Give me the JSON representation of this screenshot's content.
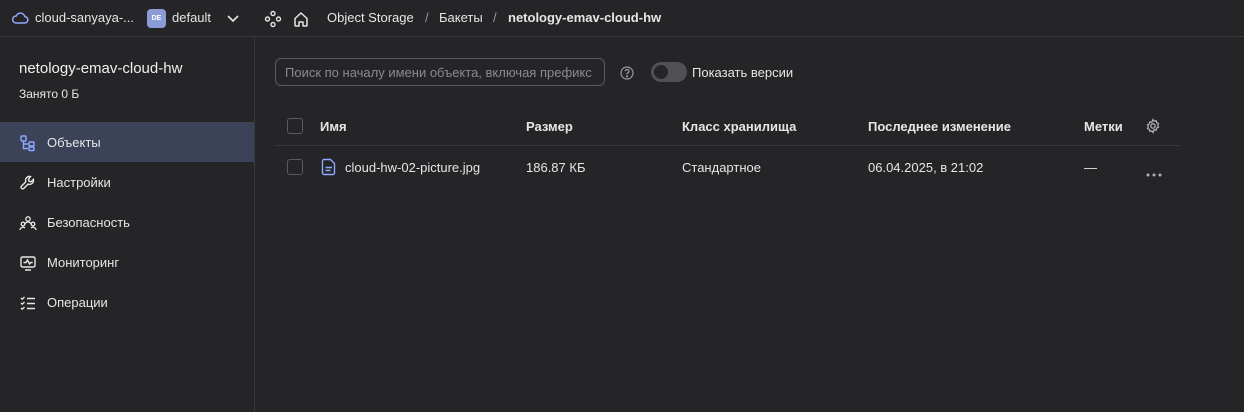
{
  "topbar": {
    "cloud_name": "cloud-sanyaya-...",
    "folder_badge": "DE",
    "folder_name": "default",
    "breadcrumbs": [
      "Object Storage",
      "Бакеты",
      "netology-emav-cloud-hw"
    ],
    "separator": "/"
  },
  "sidebar": {
    "bucket_name": "netology-emav-cloud-hw",
    "used": "Занято 0 Б",
    "items": [
      {
        "label": "Объекты",
        "icon": "objects-icon",
        "active": true
      },
      {
        "label": "Настройки",
        "icon": "wrench-icon",
        "active": false
      },
      {
        "label": "Безопасность",
        "icon": "users-icon",
        "active": false
      },
      {
        "label": "Мониторинг",
        "icon": "monitor-icon",
        "active": false
      },
      {
        "label": "Операции",
        "icon": "list-icon",
        "active": false
      }
    ]
  },
  "toolbar": {
    "search_placeholder": "Поиск по началу имени объекта, включая префикс",
    "show_versions_label": "Показать версии",
    "show_versions_on": false
  },
  "table": {
    "columns": [
      "Имя",
      "Размер",
      "Класс хранилища",
      "Последнее изменение",
      "Метки"
    ],
    "rows": [
      {
        "name": "cloud-hw-02-picture.jpg",
        "size": "186.87 КБ",
        "storage_class": "Стандартное",
        "modified": "06.04.2025, в 21:02",
        "tags": "—"
      }
    ]
  },
  "colors": {
    "background": "#252528",
    "active_nav": "#3c4358",
    "accent_icon": "#8b9bd8",
    "border": "#3a3a3e"
  }
}
